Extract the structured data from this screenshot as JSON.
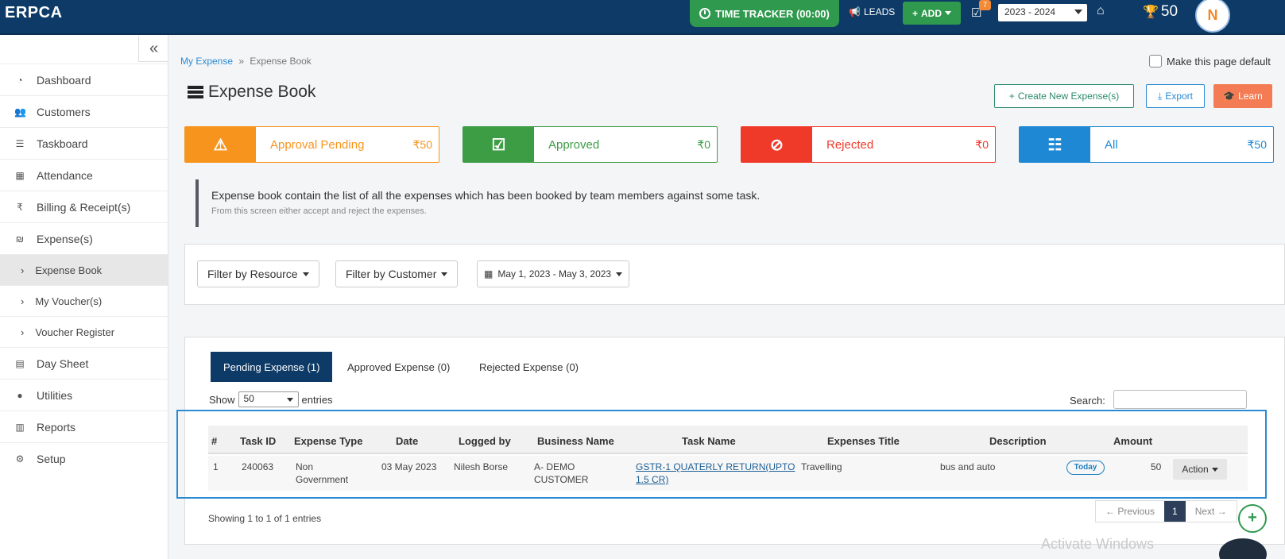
{
  "app": {
    "brand": "ERPCA"
  },
  "topbar": {
    "tracker": "TIME TRACKER (00:00)",
    "leads": "LEADS",
    "add": "ADD",
    "notif_count": "7",
    "year": "2023 - 2024",
    "points": "50",
    "avatar_letter": "N"
  },
  "sidebar": {
    "collapse": "«",
    "items": [
      {
        "label": "Dashboard",
        "icon": "dashboard-icon"
      },
      {
        "label": "Customers",
        "icon": "users-icon"
      },
      {
        "label": "Taskboard",
        "icon": "taskboard-icon"
      },
      {
        "label": "Attendance",
        "icon": "calendar-icon"
      },
      {
        "label": "Billing & Receipt(s)",
        "icon": "rupee-icon"
      },
      {
        "label": "Expense(s)",
        "icon": "expense-icon"
      },
      {
        "label": "Expense Book",
        "sub": true,
        "active": true
      },
      {
        "label": "My Voucher(s)",
        "sub": true
      },
      {
        "label": "Voucher Register",
        "sub": true
      },
      {
        "label": "Day Sheet",
        "icon": "daysheet-icon"
      },
      {
        "label": "Utilities",
        "icon": "utilities-icon"
      },
      {
        "label": "Reports",
        "icon": "reports-icon"
      },
      {
        "label": "Setup",
        "icon": "gear-icon"
      }
    ]
  },
  "breadcrumb": {
    "parent": "My Expense",
    "sep": "»",
    "current": "Expense Book"
  },
  "make_default": "Make this page default",
  "page_title": "Expense Book",
  "actions": {
    "create": "Create New Expense(s)",
    "export": "Export",
    "learn": "Learn"
  },
  "cards": [
    {
      "label": "Approval Pending",
      "amount": "₹50",
      "color": "#f7941d"
    },
    {
      "label": "Approved",
      "amount": "₹0",
      "color": "#3c9d45"
    },
    {
      "label": "Rejected",
      "amount": "₹0",
      "color": "#ef3a2a"
    },
    {
      "label": "All",
      "amount": "₹50",
      "color": "#1e88d4"
    }
  ],
  "info": {
    "line1": "Expense book contain the list of all the expenses which has been booked by team members against some task.",
    "line2": "From this screen either accept and reject the expenses."
  },
  "filters": {
    "resource": "Filter by Resource",
    "customer": "Filter by Customer",
    "date": "May 1, 2023 - May 3, 2023"
  },
  "tabs": [
    "Pending Expense (1)",
    "Approved Expense (0)",
    "Rejected Expense (0)"
  ],
  "table": {
    "show_label": "Show",
    "entries_value": "50",
    "entries_label": "entries",
    "search_label": "Search:",
    "columns": [
      "#",
      "Task ID",
      "Expense Type",
      "Date",
      "Logged by",
      "Business Name",
      "Task Name",
      "Expenses Title",
      "Description",
      "Amount"
    ],
    "row": {
      "num": "1",
      "task_id": "240063",
      "expense_type_1": "Non",
      "expense_type_2": "Government",
      "date": "03 May 2023",
      "logged_by": "Nilesh Borse",
      "business_1": "A- DEMO",
      "business_2": "CUSTOMER",
      "task_name_1": "GSTR-1 QUATERLY RETURN(UPTO",
      "task_name_2": "1.5 CR)",
      "title": "Travelling",
      "description": "bus and auto",
      "badge": "Today",
      "amount": "50",
      "action": "Action"
    },
    "showing": "Showing 1 to 1 of 1 entries",
    "pager": {
      "prev": "← Previous",
      "page": "1",
      "next": "Next →"
    }
  },
  "watermark": "Activate Windows"
}
